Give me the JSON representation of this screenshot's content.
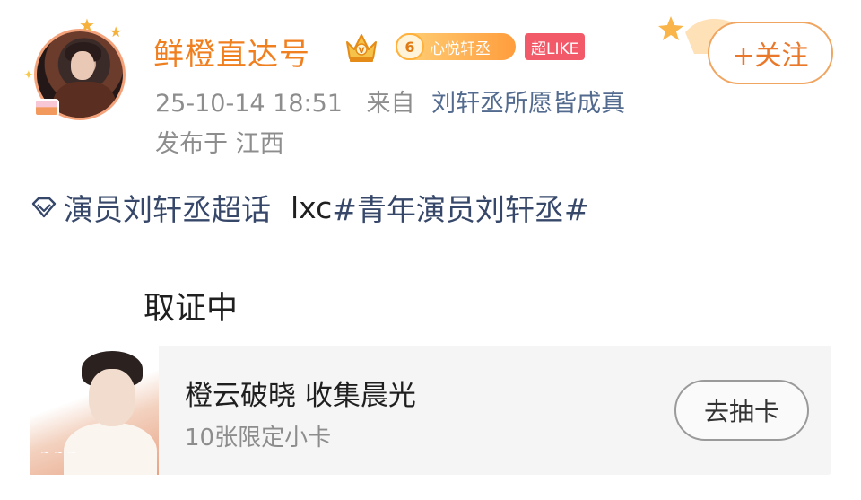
{
  "header": {
    "username": "鲜橙直达号",
    "fan_badge": {
      "level": "6",
      "name": "心悦轩丞"
    },
    "super_like_badge": "超LIKE",
    "timestamp": "25-10-14 18:51",
    "source_label": "来自",
    "source": "刘轩丞所愿皆成真",
    "location": "发布于 江西",
    "follow_label": "+关注"
  },
  "content": {
    "super_topic": "演员刘轩丞超话",
    "plain_text": "lxc",
    "hashtag": "#青年演员刘轩丞#",
    "body": "取证中"
  },
  "card": {
    "title": "橙云破晓 收集晨光",
    "subtitle": "10张限定小卡",
    "button_label": "去抽卡"
  },
  "icons": {
    "verified_crown": "crown-icon",
    "super_topic": "diamond-chaohua-icon"
  },
  "colors": {
    "username": "#f07f20",
    "link": "#536b8f",
    "topic": "#36476a",
    "follow": "#e9782a",
    "super_like_bg": "#f25a6a"
  }
}
